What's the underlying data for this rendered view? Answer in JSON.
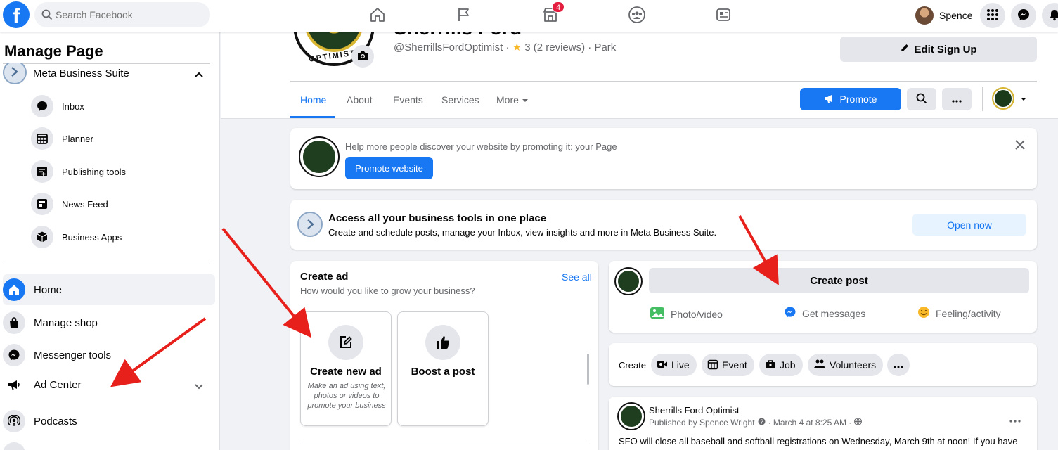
{
  "topbar": {
    "logo_letter": "f",
    "search_placeholder": "Search Facebook",
    "marketplace_badge": "4",
    "user_name": "Spence"
  },
  "sidebar": {
    "title": "Manage Page",
    "suite_label": "Meta Business Suite",
    "sub_items": [
      {
        "label": "Inbox",
        "icon": "chat-bubble-icon"
      },
      {
        "label": "Planner",
        "icon": "calendar-icon"
      },
      {
        "label": "Publishing tools",
        "icon": "publishing-tools-icon"
      },
      {
        "label": "News Feed",
        "icon": "news-feed-icon"
      },
      {
        "label": "Business Apps",
        "icon": "cube-icon"
      }
    ],
    "main_items": [
      {
        "label": "Home",
        "icon": "home-icon"
      },
      {
        "label": "Manage shop",
        "icon": "shopping-bag-icon"
      },
      {
        "label": "Messenger tools",
        "icon": "messenger-icon"
      },
      {
        "label": "Ad Center",
        "icon": "megaphone-icon"
      },
      {
        "label": "Podcasts",
        "icon": "podcast-icon"
      }
    ]
  },
  "page": {
    "name": "Sherrills Ford Optimist",
    "avatar_text": "OPTIMIST",
    "handle": "@SherrillsFordOptimist",
    "rating": "3 (2 reviews)",
    "category": "Park",
    "edit_button": "Edit Sign Up",
    "tabs": [
      "Home",
      "About",
      "Events",
      "Services",
      "More"
    ],
    "promote_button": "Promote"
  },
  "promo_card": {
    "text": "Help more people discover your website by promoting it: your Page",
    "button": "Promote website"
  },
  "suite_card": {
    "title": "Access all your business tools in one place",
    "text": "Create and schedule posts, manage your Inbox, view insights and more in Meta Business Suite.",
    "button": "Open now"
  },
  "create_ad": {
    "title": "Create ad",
    "subtitle": "How would you like to grow your business?",
    "see_all": "See all",
    "tiles": [
      {
        "title": "Create new ad",
        "desc": "Make an ad using text, photos or videos to promote your business"
      },
      {
        "title": "Boost a post",
        "desc": ""
      }
    ]
  },
  "composer": {
    "create_post": "Create post",
    "actions": [
      "Photo/video",
      "Get messages",
      "Feeling/activity"
    ]
  },
  "create_row": {
    "label": "Create",
    "chips": [
      "Live",
      "Event",
      "Job",
      "Volunteers"
    ]
  },
  "post": {
    "author": "Sherrills Ford Optimist",
    "meta": "Published by Spence Wright",
    "date": "March 4 at 8:25 AM",
    "text": "SFO will close all baseball and softball registrations on Wednesday, March 9th at noon! If you have"
  },
  "colors": {
    "brand_blue": "#1877f2",
    "arrow_red": "#e8201c"
  }
}
